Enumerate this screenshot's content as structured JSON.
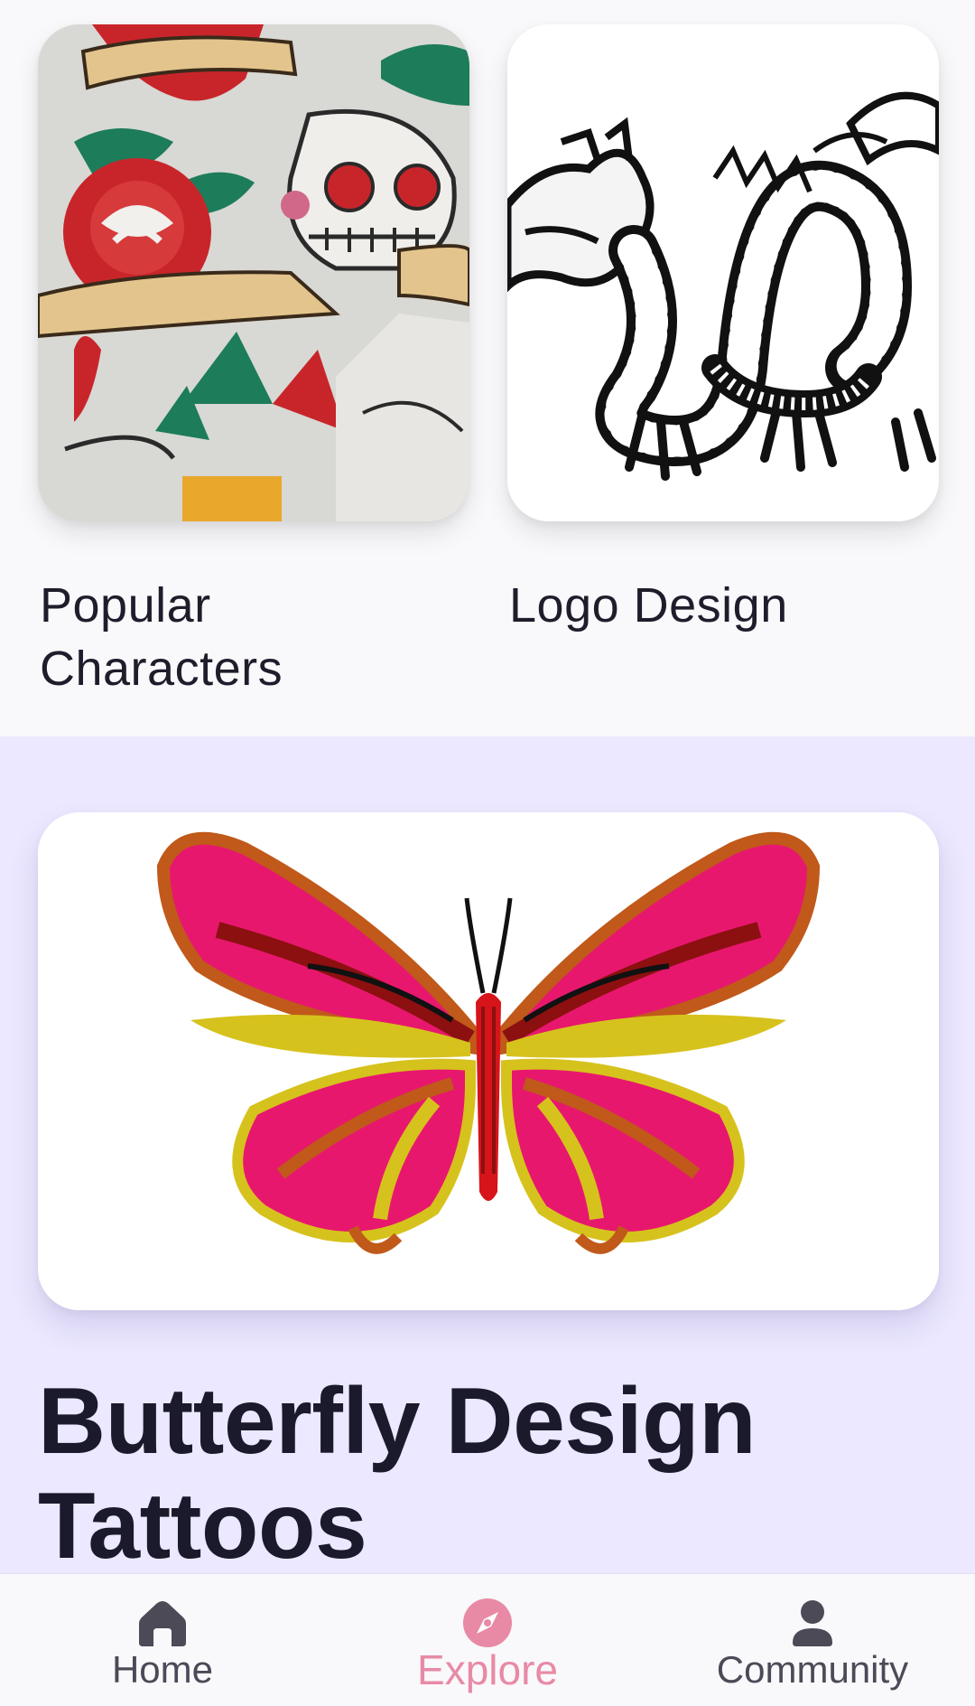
{
  "categories": [
    {
      "title": "Popular Characters",
      "image": "old-school-flash-tattoo-image"
    },
    {
      "title": "Logo Design",
      "image": "dragon-line-art-image"
    }
  ],
  "featured": {
    "title": "Butterfly Design Tattoos",
    "image": "butterfly-tattoo-image"
  },
  "bottom_nav": {
    "items": [
      {
        "label": "Home",
        "icon": "home-icon",
        "active": false
      },
      {
        "label": "Explore",
        "icon": "compass-icon",
        "active": true
      },
      {
        "label": "Community",
        "icon": "person-icon",
        "active": false
      }
    ]
  },
  "colors": {
    "background": "#f9f9fb",
    "featured_background": "#ebe8ff",
    "accent": "#e88aa5",
    "text": "#1c1b29"
  }
}
